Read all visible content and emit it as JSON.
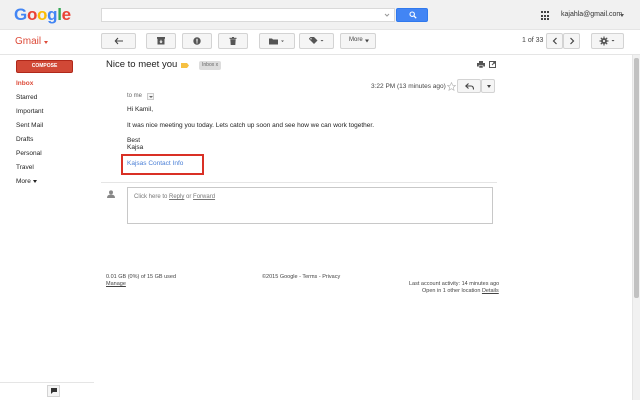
{
  "header": {
    "logo_letters": [
      {
        "ch": "G",
        "color": "#4285f4"
      },
      {
        "ch": "o",
        "color": "#ea4335"
      },
      {
        "ch": "o",
        "color": "#fbbc05"
      },
      {
        "ch": "g",
        "color": "#4285f4"
      },
      {
        "ch": "l",
        "color": "#34a853"
      },
      {
        "ch": "e",
        "color": "#ea4335"
      }
    ],
    "search_value": "",
    "account_email": "kajahla@gmail.com"
  },
  "toolbar": {
    "app_label": "Gmail",
    "more_label": "More",
    "page_count": "1 of 33"
  },
  "sidebar": {
    "compose_label": "COMPOSE",
    "items": [
      {
        "label": "Inbox"
      },
      {
        "label": "Starred"
      },
      {
        "label": "Important"
      },
      {
        "label": "Sent Mail"
      },
      {
        "label": "Drafts"
      },
      {
        "label": "Personal"
      },
      {
        "label": "Travel"
      },
      {
        "label": "More"
      }
    ]
  },
  "message": {
    "subject": "Nice to meet you",
    "label_chip": "Inbox",
    "label_chip_close": "x",
    "date": "3:22 PM (13 minutes ago)",
    "to": "to me",
    "body": {
      "greeting": "Hi Kamil,",
      "line1": "It was nice meeting you today.  Lets catch up soon and see how we can work together.",
      "closing": "Best",
      "signature": "Kajsa",
      "link": "Kajsas Contact Info"
    },
    "reply_prefix": "Click here to ",
    "reply_link": "Reply",
    "reply_or": " or ",
    "forward_link": "Forward"
  },
  "footer": {
    "storage": "0.01 GB (0%) of 15 GB used",
    "manage": "Manage",
    "copyright": "©2015 Google - Terms - Privacy",
    "activity": "Last account activity: 14 minutes ago",
    "other_location_prefix": "Open in 1 other location",
    "details": "Details"
  },
  "colors": {
    "accent_red": "#dd4b39",
    "compose_red": "#d14836",
    "search_blue": "#4285f4",
    "link_blue": "#4a7fd6",
    "highlight_box": "#d93025"
  }
}
